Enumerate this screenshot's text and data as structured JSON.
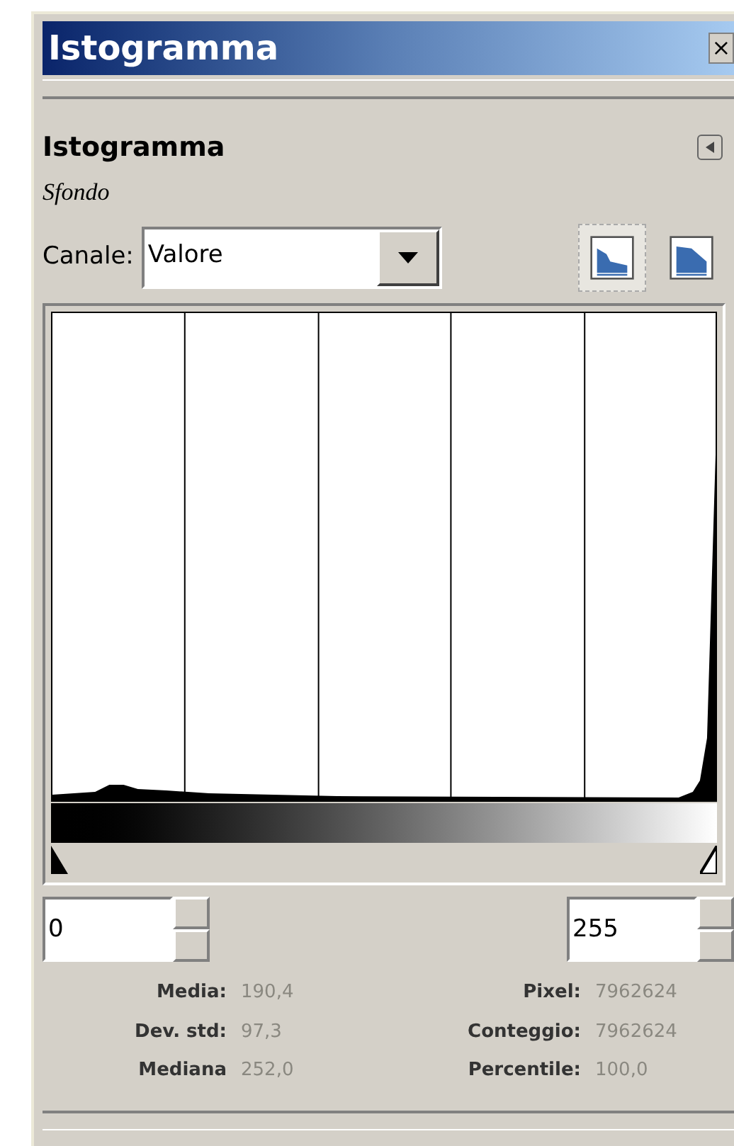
{
  "window": {
    "title": "Istogramma",
    "close": "×"
  },
  "panel": {
    "heading": "Istogramma",
    "layer": "Sfondo"
  },
  "channel": {
    "label": "Canale:",
    "value": "Valore"
  },
  "view_modes": [
    {
      "kind": "linear",
      "selected": true
    },
    {
      "kind": "logarithmic",
      "selected": false
    }
  ],
  "range": {
    "low": "0",
    "high": "255"
  },
  "stats_left": [
    {
      "label": "Media:",
      "value": "190,4"
    },
    {
      "label": "Dev. std:",
      "value": "97,3"
    },
    {
      "label": "Mediana",
      "value": "252,0"
    }
  ],
  "stats_right": [
    {
      "label": "Pixel:",
      "value": "7962624"
    },
    {
      "label": "Conteggio:",
      "value": "7962624"
    },
    {
      "label": "Percentile:",
      "value": "100,0"
    }
  ]
}
